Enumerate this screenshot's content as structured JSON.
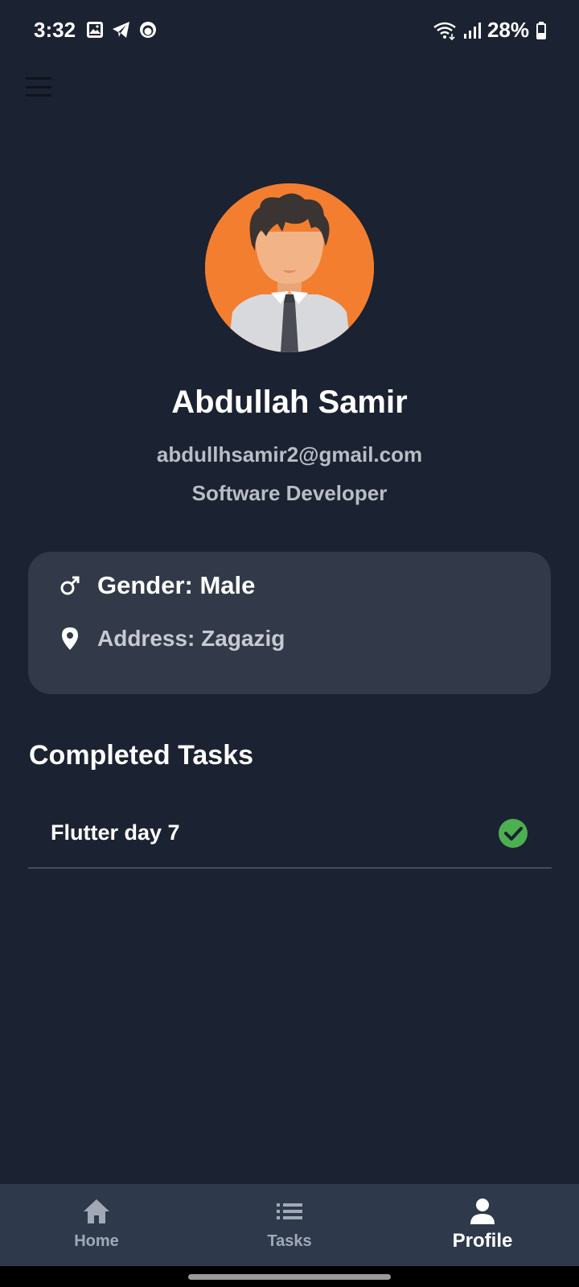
{
  "status_bar": {
    "time": "3:32",
    "battery": "28%",
    "icons": [
      "gallery-icon",
      "telegram-icon",
      "app-notification-icon",
      "wifi-icon",
      "signal-icon",
      "battery-icon"
    ]
  },
  "header": {
    "menu_icon": "hamburger-menu-icon"
  },
  "profile": {
    "name": "Abdullah Samir",
    "email": "abdullhsamir2@gmail.com",
    "role": "Software Developer",
    "avatar_bg": "#f47e2f"
  },
  "info": {
    "gender": "Gender: Male",
    "address": "Address: Zagazig"
  },
  "completed_tasks": {
    "title": "Completed Tasks",
    "items": [
      {
        "label": "Flutter day 7",
        "status_icon": "check-circle-icon",
        "status_color": "#4caf50"
      }
    ]
  },
  "bottom_nav": {
    "items": [
      {
        "label": "Home",
        "icon": "home-icon",
        "active": false
      },
      {
        "label": "Tasks",
        "icon": "list-icon",
        "active": false
      },
      {
        "label": "Profile",
        "icon": "person-icon",
        "active": true
      }
    ]
  },
  "colors": {
    "background": "#1b2231",
    "card": "#323a49",
    "nav_bar": "#2e3a4b",
    "accent": "#f47e2f",
    "success": "#4caf50"
  }
}
